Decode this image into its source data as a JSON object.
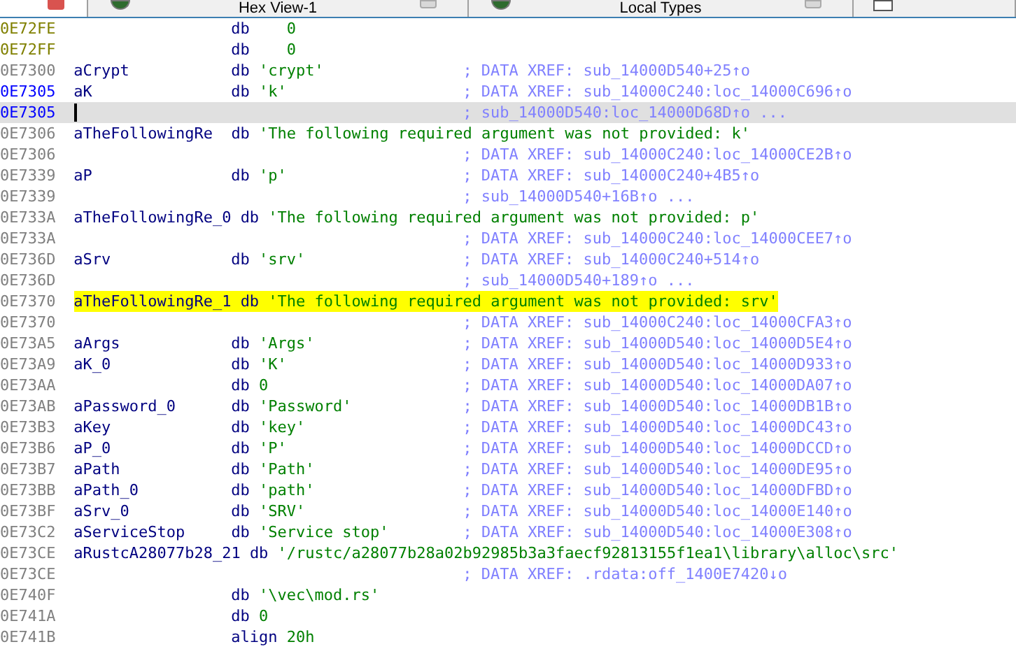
{
  "tabs": [
    {
      "selected": true
    },
    {
      "label": "Hex View-1",
      "selected": false
    },
    {
      "label": "Local Types",
      "selected": false
    },
    {
      "selected": false
    }
  ],
  "listing": [
    {
      "kind": "unexplored",
      "address": "0E72FE",
      "mnemonic": "db",
      "operand": "0"
    },
    {
      "kind": "unexplored",
      "address": "0E72FF",
      "mnemonic": "db",
      "operand": "0"
    },
    {
      "kind": "data",
      "address": "0E7300",
      "label": "aCrypt",
      "mnemonic": "db",
      "operand": "'crypt'",
      "comment": "; DATA XREF: sub_14000D540+25↑o"
    },
    {
      "kind": "data",
      "address": "0E7305",
      "current": true,
      "label": "aK",
      "mnemonic": "db",
      "operand": "'k'",
      "comment": "; DATA XREF: sub_14000C240:loc_14000C696↑o"
    },
    {
      "kind": "data",
      "address": "0E7305",
      "current": true,
      "selected": true,
      "comment": "; sub_14000D540:loc_14000D68D↑o ..."
    },
    {
      "kind": "data",
      "address": "0E7306",
      "label": "aTheFollowingRe",
      "mnemonic": "db",
      "operand": "'The following required argument was not provided: k'"
    },
    {
      "kind": "data",
      "address": "0E7306",
      "comment": "; DATA XREF: sub_14000C240:loc_14000CE2B↑o"
    },
    {
      "kind": "data",
      "address": "0E7339",
      "label": "aP",
      "mnemonic": "db",
      "operand": "'p'",
      "comment": "; DATA XREF: sub_14000C240+4B5↑o"
    },
    {
      "kind": "data",
      "address": "0E7339",
      "comment": "; sub_14000D540+16B↑o ..."
    },
    {
      "kind": "data",
      "address": "0E733A",
      "label": "aTheFollowingRe_0",
      "mnemonic": "db",
      "operand": "'The following required argument was not provided: p'"
    },
    {
      "kind": "data",
      "address": "0E733A",
      "comment": "; DATA XREF: sub_14000C240:loc_14000CEE7↑o"
    },
    {
      "kind": "data",
      "address": "0E736D",
      "label": "aSrv",
      "mnemonic": "db",
      "operand": "'srv'",
      "comment": "; DATA XREF: sub_14000C240+514↑o"
    },
    {
      "kind": "data",
      "address": "0E736D",
      "comment": "; sub_14000D540+189↑o ..."
    },
    {
      "kind": "data",
      "address": "0E7370",
      "highlighted": true,
      "label": "aTheFollowingRe_1",
      "mnemonic": "db",
      "operand": "'The following required argument was not provided: srv'"
    },
    {
      "kind": "data",
      "address": "0E7370",
      "comment": "; DATA XREF: sub_14000C240:loc_14000CFA3↑o"
    },
    {
      "kind": "data",
      "address": "0E73A5",
      "label": "aArgs",
      "mnemonic": "db",
      "operand": "'Args'",
      "comment": "; DATA XREF: sub_14000D540:loc_14000D5E4↑o"
    },
    {
      "kind": "data",
      "address": "0E73A9",
      "label": "aK_0",
      "mnemonic": "db",
      "operand": "'K'",
      "comment": "; DATA XREF: sub_14000D540:loc_14000D933↑o"
    },
    {
      "kind": "data",
      "address": "0E73AA",
      "mnemonic": "db",
      "operand": "0",
      "comment": "; DATA XREF: sub_14000D540:loc_14000DA07↑o"
    },
    {
      "kind": "data",
      "address": "0E73AB",
      "label": "aPassword_0",
      "mnemonic": "db",
      "operand": "'Password'",
      "comment": "; DATA XREF: sub_14000D540:loc_14000DB1B↑o"
    },
    {
      "kind": "data",
      "address": "0E73B3",
      "label": "aKey",
      "mnemonic": "db",
      "operand": "'key'",
      "comment": "; DATA XREF: sub_14000D540:loc_14000DC43↑o"
    },
    {
      "kind": "data",
      "address": "0E73B6",
      "label": "aP_0",
      "mnemonic": "db",
      "operand": "'P'",
      "comment": "; DATA XREF: sub_14000D540:loc_14000DCCD↑o"
    },
    {
      "kind": "data",
      "address": "0E73B7",
      "label": "aPath",
      "mnemonic": "db",
      "operand": "'Path'",
      "comment": "; DATA XREF: sub_14000D540:loc_14000DE95↑o"
    },
    {
      "kind": "data",
      "address": "0E73BB",
      "label": "aPath_0",
      "mnemonic": "db",
      "operand": "'path'",
      "comment": "; DATA XREF: sub_14000D540:loc_14000DFBD↑o"
    },
    {
      "kind": "data",
      "address": "0E73BF",
      "label": "aSrv_0",
      "mnemonic": "db",
      "operand": "'SRV'",
      "comment": "; DATA XREF: sub_14000D540:loc_14000E140↑o"
    },
    {
      "kind": "data",
      "address": "0E73C2",
      "label": "aServiceStop",
      "mnemonic": "db",
      "operand": "'Service stop'",
      "comment": "; DATA XREF: sub_14000D540:loc_14000E308↑o"
    },
    {
      "kind": "data",
      "address": "0E73CE",
      "label": "aRustcA28077b28_21",
      "mnemonic": "db",
      "operand": "'/rustc/a28077b28a02b92985b3a3faecf92813155f1ea1\\library\\alloc\\src'"
    },
    {
      "kind": "data",
      "address": "0E73CE",
      "comment": "; DATA XREF: .rdata:off_1400E7420↓o"
    },
    {
      "kind": "data",
      "address": "0E740F",
      "mnemonic": "db",
      "operand": "'\\vec\\mod.rs'"
    },
    {
      "kind": "data",
      "address": "0E741A",
      "mnemonic": "db",
      "operand": "0"
    },
    {
      "kind": "data",
      "address": "0E741B",
      "mnemonic": "align",
      "operand": "20h"
    }
  ]
}
